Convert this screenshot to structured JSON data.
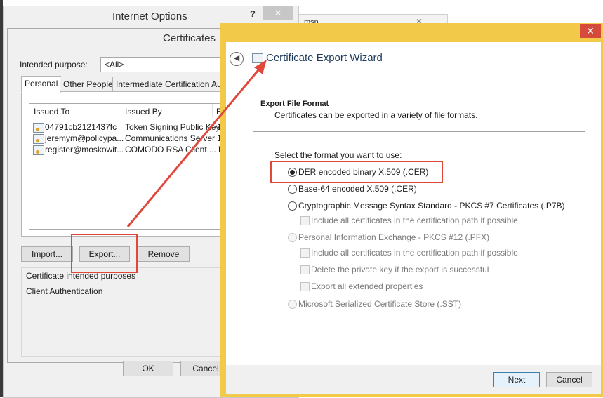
{
  "background_window": {
    "tab_text": "msn"
  },
  "internet_options": {
    "title": "Internet Options",
    "help": "?",
    "close": "✕"
  },
  "certificates": {
    "title": "Certificates",
    "intended_purpose_label": "Intended purpose:",
    "intended_purpose_value": "<All>",
    "tabs": [
      "Personal",
      "Other People",
      "Intermediate Certification Auth"
    ],
    "columns": [
      "Issued To",
      "Issued By",
      "E"
    ],
    "rows": [
      {
        "issued_to": "04791cb2121437fc",
        "issued_by": "Token Signing Public Key",
        "exp": "1"
      },
      {
        "issued_to": "jeremym@policypa...",
        "issued_by": "Communications Server",
        "exp": "1"
      },
      {
        "issued_to": "register@moskowit...",
        "issued_by": "COMODO RSA Client ...",
        "exp": "1"
      }
    ],
    "buttons": {
      "import": "Import...",
      "export": "Export...",
      "remove": "Remove"
    },
    "purposes_label": "Certificate intended purposes",
    "purposes_value": "Client Authentication",
    "ok": "OK",
    "cancel": "Cancel"
  },
  "wizard": {
    "title": "Certificate Export Wizard",
    "close": "✕",
    "back_icon": "back-arrow-icon",
    "section_title": "Export File Format",
    "section_desc": "Certificates can be exported in a variety of file formats.",
    "select_label": "Select the format you want to use:",
    "options": {
      "der": "DER encoded binary X.509 (.CER)",
      "base64": "Base-64 encoded X.509 (.CER)",
      "p7b": "Cryptographic Message Syntax Standard - PKCS #7 Certificates (.P7B)",
      "p7b_include": "Include all certificates in the certification path if possible",
      "pfx": "Personal Information Exchange - PKCS #12 (.PFX)",
      "pfx_include": "Include all certificates in the certification path if possible",
      "pfx_delete": "Delete the private key if the export is successful",
      "pfx_extended": "Export all extended properties",
      "sst": "Microsoft Serialized Certificate Store (.SST)"
    },
    "selected_option": "der",
    "next": "Next",
    "cancel": "Cancel"
  },
  "colors": {
    "wizard_frame": "#f3c94a",
    "annotation": "#e0483c",
    "close_red": "#d64a3b"
  }
}
